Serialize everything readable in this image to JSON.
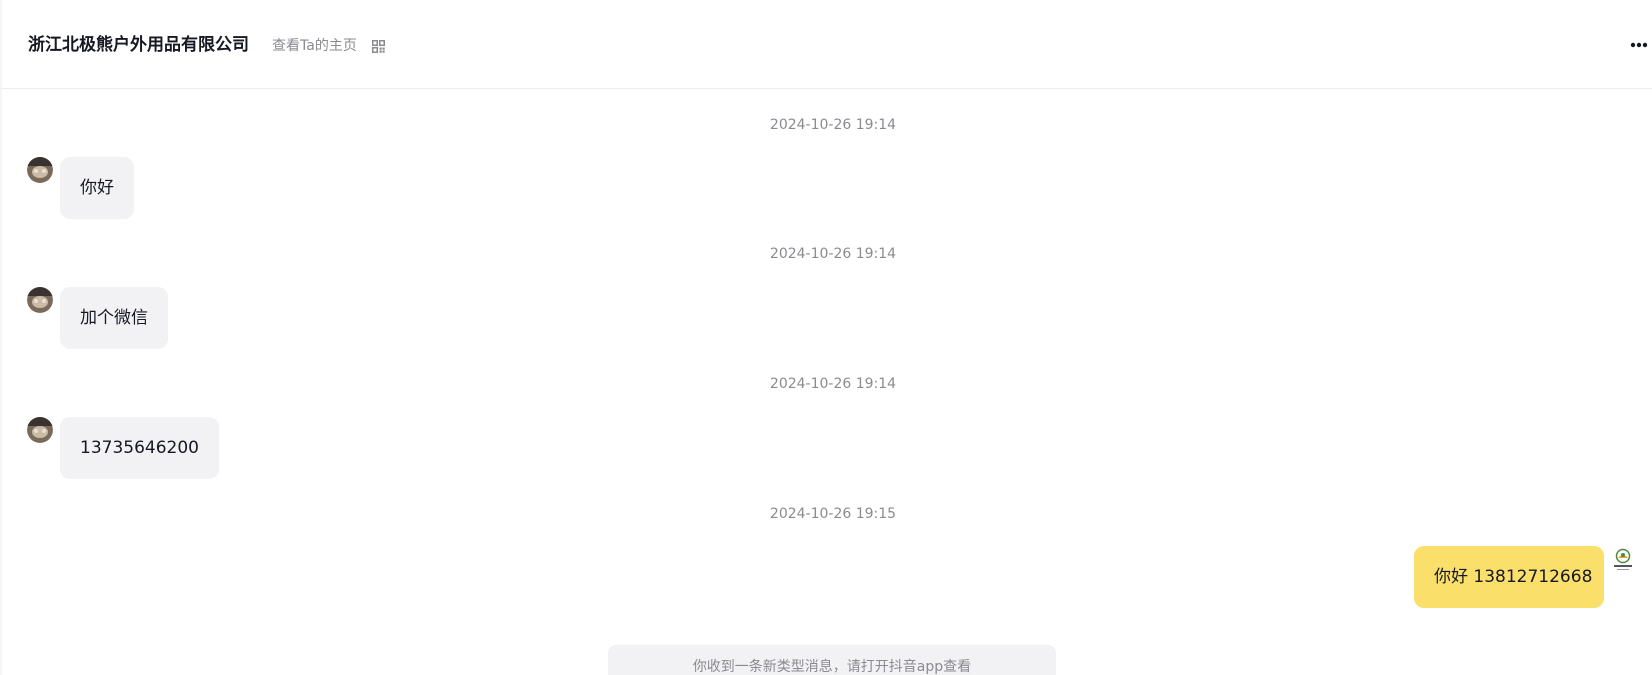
{
  "header": {
    "title": "浙江北极熊户外用品有限公司",
    "profile_link": "查看Ta的主页",
    "qr_icon": "qr-code-icon",
    "more_icon": "more-dots-icon"
  },
  "messages": [
    {
      "timestamp": "2024-10-26 19:14",
      "direction": "incoming",
      "text": "你好"
    },
    {
      "timestamp": "2024-10-26 19:14",
      "direction": "incoming",
      "text": "加个微信"
    },
    {
      "timestamp": "2024-10-26 19:14",
      "direction": "incoming",
      "text": "13735646200"
    },
    {
      "timestamp": "2024-10-26 19:15",
      "direction": "outgoing",
      "text": "你好  13812712668"
    }
  ],
  "notice": {
    "text": "你收到一条新类型消息，请打开抖音app查看"
  },
  "colors": {
    "incoming_bubble": "#f2f2f4",
    "outgoing_bubble": "#fae06b",
    "timestamp_text": "#8a8b91",
    "title_text": "#161823"
  }
}
